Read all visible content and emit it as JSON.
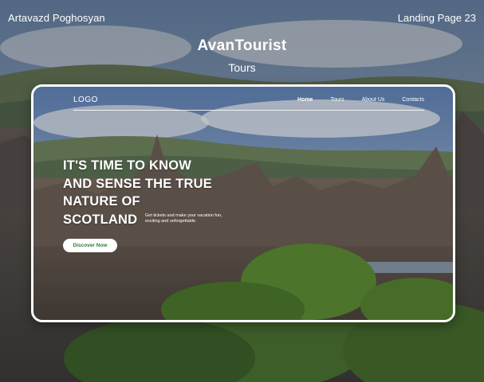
{
  "presenter": "Artavazd Poghosyan",
  "page_label": "Landing Page 23",
  "title": "AvanTourist",
  "subtitle": "Tours",
  "preview": {
    "logo": "LOGO",
    "nav": [
      {
        "label": "Home",
        "active": true
      },
      {
        "label": "Tours",
        "active": false
      },
      {
        "label": "About Us",
        "active": false
      },
      {
        "label": "Contacts",
        "active": false
      }
    ],
    "hero_heading": "IT'S TIME TO KNOW AND SENSE THE TRUE NATURE OF SCOTLAND",
    "hero_text": "Get tickets and make your vacation fun, exciting and unforgettable.",
    "cta_label": "Discover Now"
  },
  "colors": {
    "cta_text": "#2e7d32",
    "frame_border": "#ffffff"
  }
}
